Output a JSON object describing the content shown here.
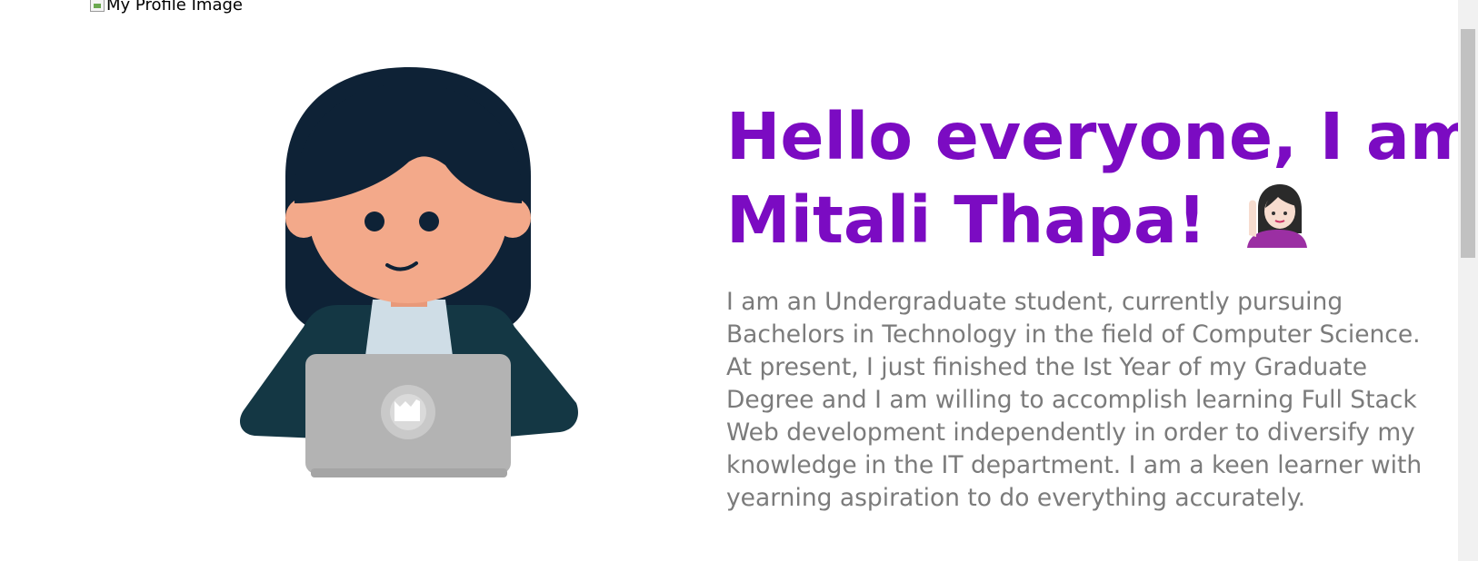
{
  "profile_image": {
    "alt": "My Profile Image"
  },
  "hero": {
    "headline_line1": "Hello everyone, I am",
    "headline_line2": "Mitali Thapa!",
    "emoji_icon": "woman-raising-hand-emoji",
    "bio": "I am an Undergraduate student, currently pursuing Bachelors in Technology in the field of Computer Science. At present, I just finished the Ist Year of my Graduate Degree and I am willing to accomplish learning Full Stack Web development independently in order to diversify my knowledge in the IT department. I am a keen learner with yearning aspiration to do everything accurately."
  },
  "illustration": {
    "icon": "girl-with-laptop-illustration"
  },
  "colors": {
    "headline": "#7b0bc2",
    "bio_text": "#7b7b7b",
    "background": "#ffffff"
  }
}
